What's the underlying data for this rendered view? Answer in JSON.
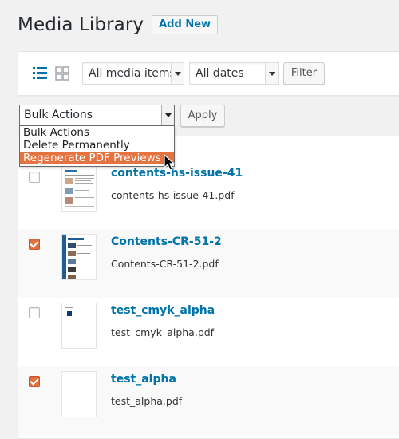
{
  "header": {
    "title": "Media Library",
    "add_new": "Add New"
  },
  "toolbar": {
    "type_filter": "All media items",
    "date_filter": "All dates",
    "filter_button": "Filter"
  },
  "bulk": {
    "selected": "Bulk Actions",
    "apply": "Apply",
    "options": [
      "Bulk Actions",
      "Delete Permanently",
      "Regenerate PDF Previews"
    ],
    "highlighted_index": 2
  },
  "colors": {
    "accent": "#e4733f",
    "link": "#0073aa"
  },
  "media": [
    {
      "title": "contents-hs-issue-41",
      "filename": "contents-hs-issue-41.pdf",
      "checked": false
    },
    {
      "title": "Contents-CR-51-2",
      "filename": "Contents-CR-51-2.pdf",
      "checked": true
    },
    {
      "title": "test_cmyk_alpha",
      "filename": "test_cmyk_alpha.pdf",
      "checked": false
    },
    {
      "title": "test_alpha",
      "filename": "test_alpha.pdf",
      "checked": true
    }
  ]
}
